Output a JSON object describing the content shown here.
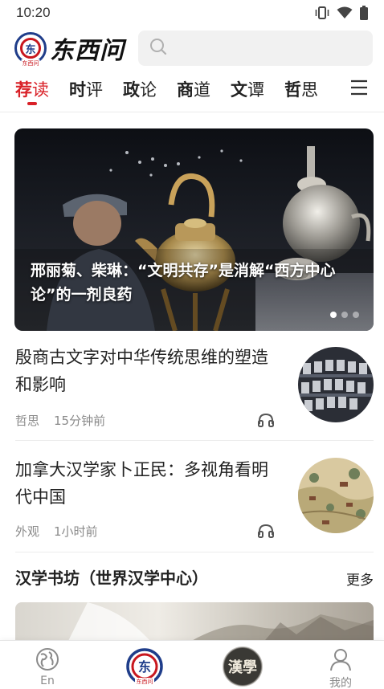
{
  "status_bar": {
    "time": "10:20",
    "icons": [
      "vibrate-icon",
      "wifi-icon",
      "battery-icon"
    ]
  },
  "header": {
    "logo_text": "东西问",
    "logo_sub": "东西问",
    "search_icon": "search-icon",
    "search_placeholder": ""
  },
  "tabs": [
    {
      "a": "荐",
      "b": "读",
      "active": true
    },
    {
      "a": "时",
      "b": "评",
      "active": false
    },
    {
      "a": "政",
      "b": "论",
      "active": false
    },
    {
      "a": "商",
      "b": "道",
      "active": false
    },
    {
      "a": "文",
      "b": "谭",
      "active": false
    },
    {
      "a": "哲",
      "b": "思",
      "active": false
    }
  ],
  "menu_icon": "menu-icon",
  "hero": {
    "title": "邢丽菊、柴琳：“文明共存”是消解“西方中心论”的一剂良药",
    "dots": 3,
    "active_dot": 0
  },
  "articles": [
    {
      "title": "殷商古文字对中华传统思维的塑造和影响",
      "category": "哲思",
      "time": "15分钟前",
      "audio_icon": "headphone-icon"
    },
    {
      "title": "加拿大汉学家卜正民：多视角看明代中国",
      "category": "外观",
      "time": "1小时前",
      "audio_icon": "headphone-icon"
    }
  ],
  "section": {
    "title": "汉学书坊（世界汉学中心）",
    "more": "更多"
  },
  "bottom_nav": {
    "items": [
      {
        "label": "En",
        "icon": "globe-icon"
      },
      {
        "label": "",
        "icon": "dongxiwen-logo-icon"
      },
      {
        "label": "",
        "icon": "hanxue-logo-icon"
      },
      {
        "label": "我的",
        "icon": "user-icon"
      }
    ]
  },
  "colors": {
    "accent": "#d92128",
    "brand_blue": "#1f3d8a",
    "meta_gray": "#8a8a8a"
  }
}
